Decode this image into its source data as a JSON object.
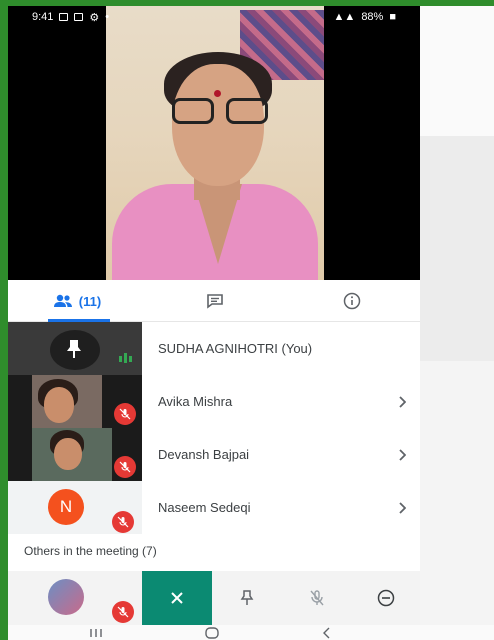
{
  "status_bar": {
    "time": "9:41",
    "battery": "88%"
  },
  "tabs": [
    {
      "label": "(11)",
      "icon": "people-icon",
      "active": true
    },
    {
      "icon": "chat-icon"
    },
    {
      "icon": "info-icon"
    }
  ],
  "participants": [
    {
      "name": "SUDHA AGNIHOTRI (You)",
      "thumb": "pin-icon",
      "status": "speaking"
    },
    {
      "name": "Avika Mishra",
      "muted": true
    },
    {
      "name": "Devansh Bajpai",
      "muted": true
    },
    {
      "name": "Naseem Sedeqi",
      "avatar_letter": "N",
      "muted": true
    }
  ],
  "others_label": "Others in the meeting (7)",
  "actions": [
    "close-icon",
    "pin-icon",
    "mute-icon",
    "remove-icon"
  ],
  "colors": {
    "accent": "#1a73e8",
    "action_teal": "#0b8a72",
    "mute_red": "#e53935",
    "avatar_orange": "#f4511e",
    "border_green": "#2f8d2c"
  }
}
